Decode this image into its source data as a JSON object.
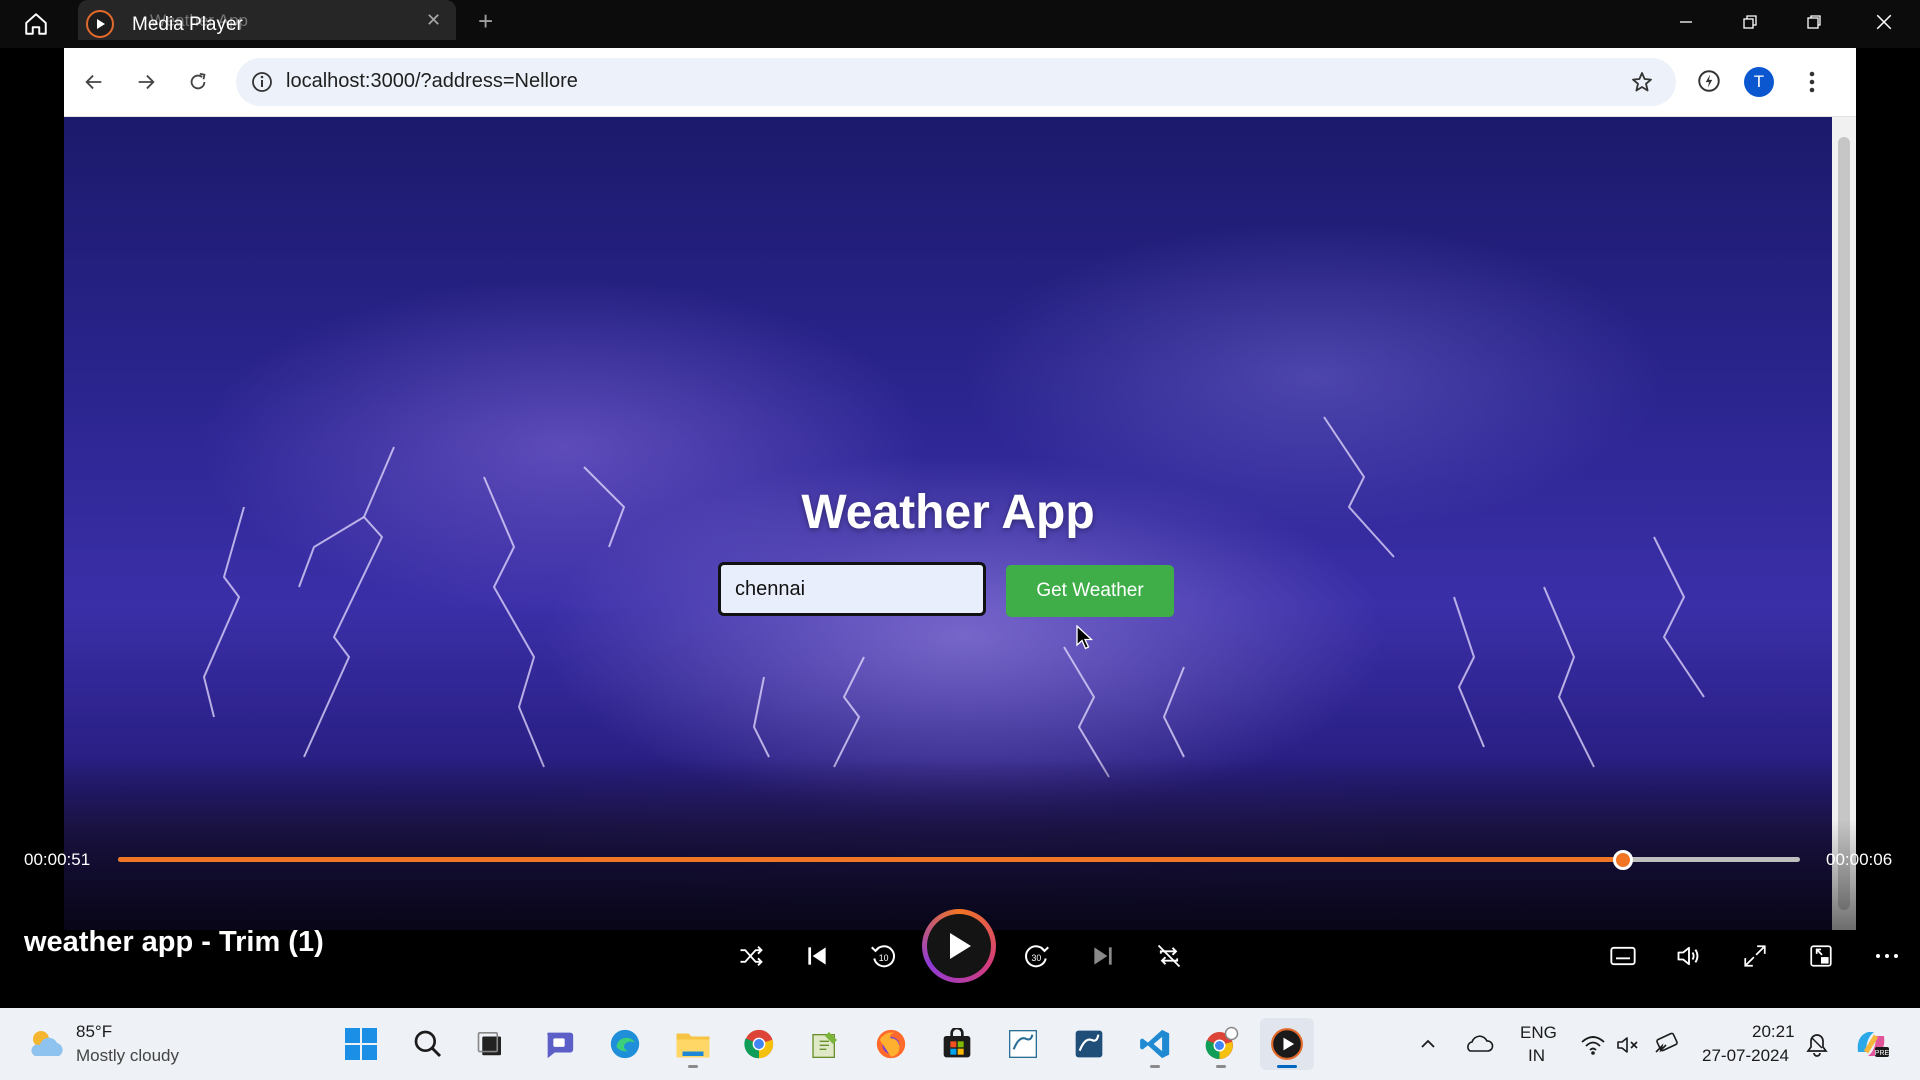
{
  "media_player": {
    "window_title": "Media Player",
    "current_time": "00:00:51",
    "remaining_time": "00:00:06",
    "progress": 0.895,
    "media_title": "weather app - Trim (1)",
    "accent_color": "#f07524"
  },
  "browser": {
    "tab_title": "Weather App",
    "url": "localhost:3000/?address=Nellore",
    "profile_initial": "T"
  },
  "weather_app": {
    "title": "Weather App",
    "input_value": "chennai",
    "button_label": "Get Weather",
    "button_color": "#3fae49"
  },
  "taskbar": {
    "weather_temp": "85°F",
    "weather_condition": "Mostly cloudy",
    "lang_line1": "ENG",
    "lang_line2": "IN",
    "time": "20:21",
    "date": "27-07-2024",
    "apps": [
      "windows-start",
      "search",
      "task-view",
      "teams-chat",
      "edge",
      "file-explorer",
      "chrome",
      "notepad-plus",
      "firefox",
      "microsoft-store",
      "mysql-installer",
      "mysql-workbench",
      "vscode",
      "chrome-profile",
      "media-player"
    ]
  }
}
